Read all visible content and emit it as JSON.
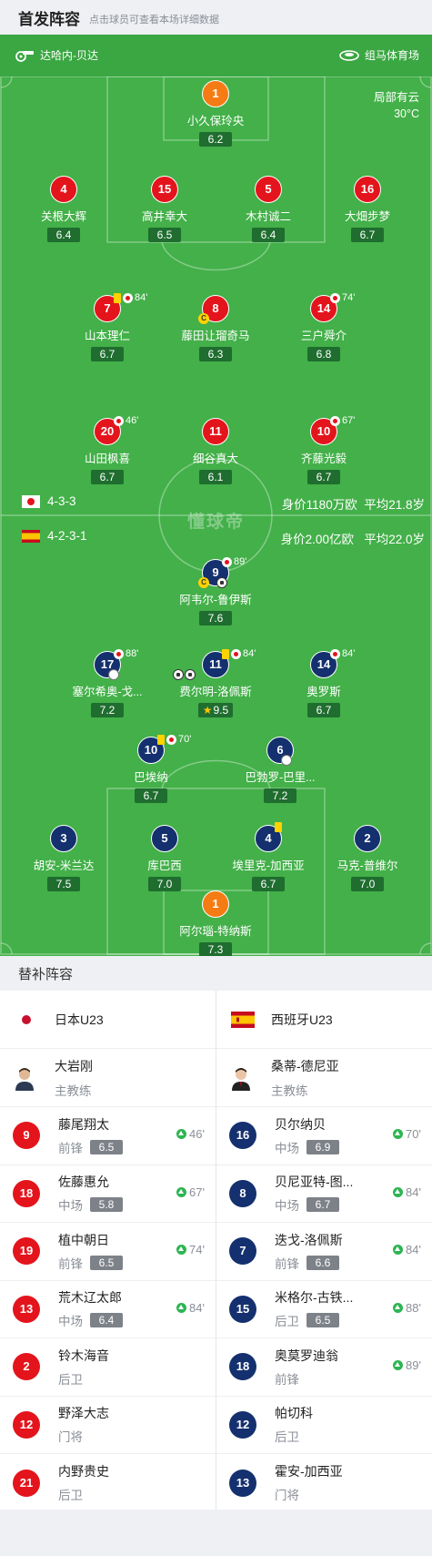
{
  "header": {
    "title": "首发阵容",
    "subtitle": "点击球员可查看本场详细数据"
  },
  "match_info": {
    "referee": "达哈内-贝达",
    "stadium": "组马体育场",
    "weather": "局部有云",
    "temperature": "30°C"
  },
  "watermark": "懂球帝",
  "home": {
    "team": "日本U23",
    "formation": "4-3-3",
    "value_text": "身价1180万欧",
    "age_text": "平均21.8岁",
    "colors": {
      "kit": "#e4141c",
      "keeper": "#f57c14"
    },
    "players": [
      {
        "num": "1",
        "name": "小久保玲央",
        "rating": "6.2",
        "gk": true
      },
      {
        "num": "4",
        "name": "关根大辉",
        "rating": "6.4"
      },
      {
        "num": "15",
        "name": "高井幸大",
        "rating": "6.5"
      },
      {
        "num": "5",
        "name": "木村诚二",
        "rating": "6.4"
      },
      {
        "num": "16",
        "name": "大畑步梦",
        "rating": "6.7"
      },
      {
        "num": "7",
        "name": "山本理仁",
        "rating": "6.7",
        "event_min": "84'",
        "yellow": true
      },
      {
        "num": "8",
        "name": "藤田让瑠奇马",
        "rating": "6.3",
        "captain": true
      },
      {
        "num": "14",
        "name": "三户舜介",
        "rating": "6.8",
        "event_min": "74'"
      },
      {
        "num": "20",
        "name": "山田枫喜",
        "rating": "6.7",
        "event_min": "46'"
      },
      {
        "num": "11",
        "name": "细谷真大",
        "rating": "6.1"
      },
      {
        "num": "10",
        "name": "齐藤光毅",
        "rating": "6.7",
        "event_min": "67'"
      }
    ]
  },
  "away": {
    "team": "西班牙U23",
    "formation": "4-2-3-1",
    "value_text": "身价2.00亿欧",
    "age_text": "平均22.0岁",
    "colors": {
      "kit": "#14306e",
      "keeper": "#f57c14"
    },
    "players": [
      {
        "num": "9",
        "name": "阿韦尔-鲁伊斯",
        "rating": "7.6",
        "event_min": "89'",
        "captain": true,
        "goals": 1
      },
      {
        "num": "17",
        "name": "塞尔希奥-戈...",
        "rating": "7.2",
        "event_min": "88'",
        "assist": true
      },
      {
        "num": "11",
        "name": "费尔明-洛佩斯",
        "rating": "9.5",
        "event_min": "84'",
        "yellow": true,
        "goals": 2,
        "mvp": true
      },
      {
        "num": "14",
        "name": "奥罗斯",
        "rating": "6.7",
        "event_min": "84'"
      },
      {
        "num": "10",
        "name": "巴埃纳",
        "rating": "6.7",
        "event_min": "70'",
        "yellow": true
      },
      {
        "num": "6",
        "name": "巴勃罗-巴里...",
        "rating": "7.2",
        "assist": true
      },
      {
        "num": "3",
        "name": "胡安-米兰达",
        "rating": "7.5"
      },
      {
        "num": "5",
        "name": "库巴西",
        "rating": "7.0"
      },
      {
        "num": "4",
        "name": "埃里克-加西亚",
        "rating": "6.7",
        "yellow": true
      },
      {
        "num": "2",
        "name": "马克-普维尔",
        "rating": "7.0"
      },
      {
        "num": "1",
        "name": "阿尔瑙-特纳斯",
        "rating": "7.3",
        "gk": true
      }
    ]
  },
  "subs": {
    "title": "替补阵容",
    "home": {
      "team": "日本U23",
      "coach": {
        "name": "大岩刚",
        "role": "主教练"
      },
      "players": [
        {
          "num": "9",
          "name": "藤尾翔太",
          "pos": "前锋",
          "rating": "6.5",
          "minute": "46'"
        },
        {
          "num": "18",
          "name": "佐藤惠允",
          "pos": "中场",
          "rating": "5.8",
          "minute": "67'"
        },
        {
          "num": "19",
          "name": "植中朝日",
          "pos": "前锋",
          "rating": "6.5",
          "minute": "74'"
        },
        {
          "num": "13",
          "name": "荒木辽太郎",
          "pos": "中场",
          "rating": "6.4",
          "minute": "84'"
        },
        {
          "num": "2",
          "name": "铃木海音",
          "pos": "后卫"
        },
        {
          "num": "12",
          "name": "野泽大志",
          "pos": "门将"
        },
        {
          "num": "21",
          "name": "内野贵史",
          "pos": "后卫"
        }
      ]
    },
    "away": {
      "team": "西班牙U23",
      "coach": {
        "name": "桑蒂-德尼亚",
        "role": "主教练"
      },
      "players": [
        {
          "num": "16",
          "name": "贝尔纳贝",
          "pos": "中场",
          "rating": "6.9",
          "minute": "70'"
        },
        {
          "num": "8",
          "name": "贝尼亚特-图...",
          "pos": "中场",
          "rating": "6.7",
          "minute": "84'"
        },
        {
          "num": "7",
          "name": "迭戈-洛佩斯",
          "pos": "前锋",
          "rating": "6.6",
          "minute": "84'"
        },
        {
          "num": "15",
          "name": "米格尔-古铁...",
          "pos": "后卫",
          "rating": "6.5",
          "minute": "88'"
        },
        {
          "num": "18",
          "name": "奥莫罗迪翁",
          "pos": "前锋",
          "minute": "89'"
        },
        {
          "num": "12",
          "name": "帕切科",
          "pos": "后卫"
        },
        {
          "num": "13",
          "name": "霍安-加西亚",
          "pos": "门将"
        }
      ]
    }
  }
}
